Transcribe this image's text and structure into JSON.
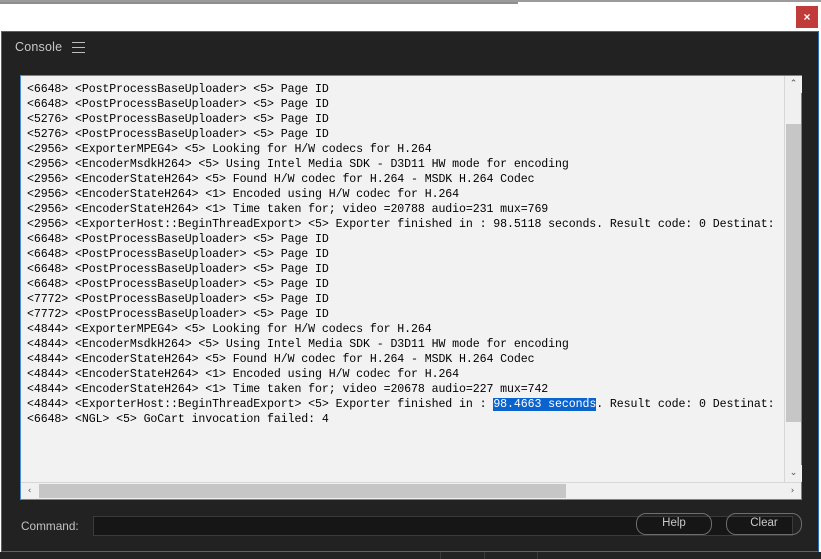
{
  "window": {
    "close_label": "×"
  },
  "panel": {
    "tab_label": "Console",
    "menu_icon": "hamburger-menu-icon",
    "accent_color": "#2a6cb8",
    "background": "#222222"
  },
  "console": {
    "selection_text": "98.4663 seconds",
    "selection_color": "#0b63ce",
    "lines": [
      "<6648> <PostProcessBaseUploader> <5> Page ID",
      "<6648> <PostProcessBaseUploader> <5> Page ID",
      "<5276> <PostProcessBaseUploader> <5> Page ID",
      "<5276> <PostProcessBaseUploader> <5> Page ID",
      "<2956> <ExporterMPEG4> <5> Looking for H/W codecs for H.264",
      "<2956> <EncoderMsdkH264> <5> Using Intel Media SDK - D3D11 HW mode for encoding",
      "<2956> <EncoderStateH264> <5> Found H/W codec for H.264 - MSDK H.264 Codec",
      "<2956> <EncoderStateH264> <1> Encoded using H/W codec for H.264",
      "<2956> <EncoderStateH264> <1> Time taken for; video =20788 audio=231 mux=769",
      "<2956> <ExporterHost::BeginThreadExport> <5> Exporter finished in : 98.5118 seconds. Result code: 0 Destinat:",
      "<6648> <PostProcessBaseUploader> <5> Page ID",
      "<6648> <PostProcessBaseUploader> <5> Page ID",
      "<6648> <PostProcessBaseUploader> <5> Page ID",
      "<6648> <PostProcessBaseUploader> <5> Page ID",
      "<7772> <PostProcessBaseUploader> <5> Page ID",
      "<7772> <PostProcessBaseUploader> <5> Page ID",
      "<4844> <ExporterMPEG4> <5> Looking for H/W codecs for H.264",
      "<4844> <EncoderMsdkH264> <5> Using Intel Media SDK - D3D11 HW mode for encoding",
      "<4844> <EncoderStateH264> <5> Found H/W codec for H.264 - MSDK H.264 Codec",
      "<4844> <EncoderStateH264> <1> Encoded using H/W codec for H.264",
      "<4844> <EncoderStateH264> <1> Time taken for; video =20678 audio=227 mux=742",
      "<6648> <NGL> <5> GoCart invocation failed: 4"
    ],
    "selected_line": {
      "prefix": "<4844> <ExporterHost::BeginThreadExport> <5> Exporter finished in : ",
      "highlight": "98.4663 seconds",
      "suffix": ". Result code: 0 Destinat:"
    }
  },
  "scrollbars": {
    "vertical_up_icon": "⌃",
    "vertical_down_icon": "⌄",
    "horizontal_left_icon": "‹",
    "horizontal_right_icon": "›"
  },
  "command": {
    "label": "Command:",
    "value": "",
    "placeholder": ""
  },
  "footer": {
    "help_label": "Help",
    "clear_label": "Clear"
  }
}
